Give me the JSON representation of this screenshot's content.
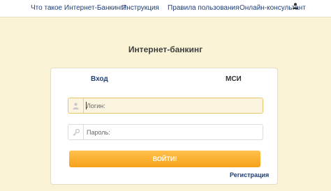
{
  "topnav": {
    "items": [
      {
        "label": "Что такое Интернет-Банкинг?"
      },
      {
        "label": "Инструкция"
      },
      {
        "label": "Правила пользования"
      },
      {
        "label": "Онлайн-консультант"
      }
    ],
    "user_icon": "user-icon"
  },
  "page": {
    "title": "Интернет-банкинг"
  },
  "tabs": {
    "login": "Вход",
    "msi": "МСИ"
  },
  "form": {
    "login_placeholder": "Логин:",
    "login_icon": "user-icon",
    "password_placeholder": "Пароль:",
    "password_icon": "key-icon",
    "submit_label": "ВОЙТИ!",
    "register_label": "Регистрация"
  },
  "colors": {
    "background": "#faf3d6",
    "link": "#1f3f7a",
    "button": "#f6a219",
    "active_field_border": "#e9c66a"
  }
}
